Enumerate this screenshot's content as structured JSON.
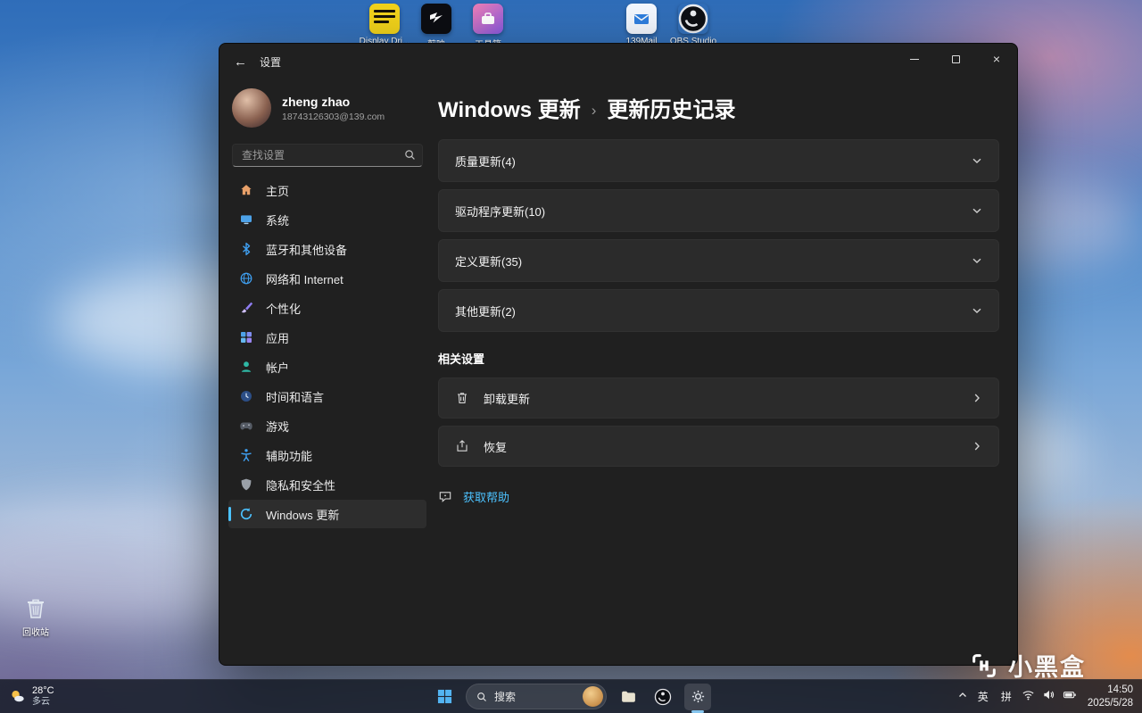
{
  "desktop": {
    "icons": [
      {
        "label": "Display Dri..."
      },
      {
        "label": "剪映"
      },
      {
        "label": "工具箱"
      },
      {
        "label": "139Mail"
      },
      {
        "label": "OBS Studio"
      }
    ],
    "recycle_bin": "回收站",
    "watermark": "小黑盒"
  },
  "widget": {
    "temp": "28°C",
    "condition": "多云"
  },
  "settings": {
    "title": "设置",
    "user": {
      "name": "zheng zhao",
      "email": "18743126303@139.com"
    },
    "search_placeholder": "查找设置",
    "nav": [
      {
        "label": "主页"
      },
      {
        "label": "系统"
      },
      {
        "label": "蓝牙和其他设备"
      },
      {
        "label": "网络和 Internet"
      },
      {
        "label": "个性化"
      },
      {
        "label": "应用"
      },
      {
        "label": "帐户"
      },
      {
        "label": "时间和语言"
      },
      {
        "label": "游戏"
      },
      {
        "label": "辅助功能"
      },
      {
        "label": "隐私和安全性"
      },
      {
        "label": "Windows 更新"
      }
    ],
    "breadcrumb": {
      "root": "Windows 更新",
      "separator": "›",
      "current": "更新历史记录"
    },
    "expanders": [
      {
        "label": "质量更新(4)"
      },
      {
        "label": "驱动程序更新(10)"
      },
      {
        "label": "定义更新(35)"
      },
      {
        "label": "其他更新(2)"
      }
    ],
    "related_title": "相关设置",
    "related": [
      {
        "label": "卸载更新"
      },
      {
        "label": "恢复"
      }
    ],
    "help": "获取帮助"
  },
  "taskbar": {
    "search": "搜索",
    "tray": {
      "lang": "英",
      "ime": "拼",
      "time": "14:50",
      "date": "2025/5/28"
    }
  }
}
